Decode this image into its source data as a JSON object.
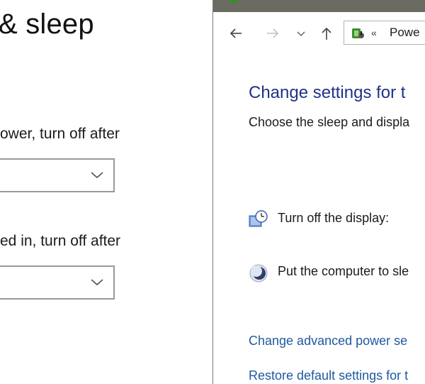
{
  "settings": {
    "title": "& sleep",
    "battery_label": "ower, turn off after",
    "plugged_label": "ed in, turn off after",
    "battery_select_value": "",
    "plugged_select_value": ""
  },
  "control_panel": {
    "nav": {
      "back_icon": "arrow-left-icon",
      "forward_icon": "arrow-right-icon",
      "recent_icon": "chevron-down-icon",
      "up_icon": "arrow-up-icon"
    },
    "address": {
      "separator": "«",
      "text": "Powe"
    },
    "heading": "Change settings for t",
    "subheading": "Choose the sleep and displa",
    "rows": [
      {
        "label": "Turn off the display:",
        "icon": "display-clock-icon"
      },
      {
        "label": "Put the computer to sle",
        "icon": "moon-sleep-icon"
      }
    ],
    "links": {
      "advanced": "Change advanced power se",
      "restore": "Restore default settings for t"
    }
  },
  "colors": {
    "link_blue": "#1e5aa0",
    "heading_blue": "#1e3287",
    "titlebar": "#6b6b62",
    "combo_border": "#999999"
  }
}
